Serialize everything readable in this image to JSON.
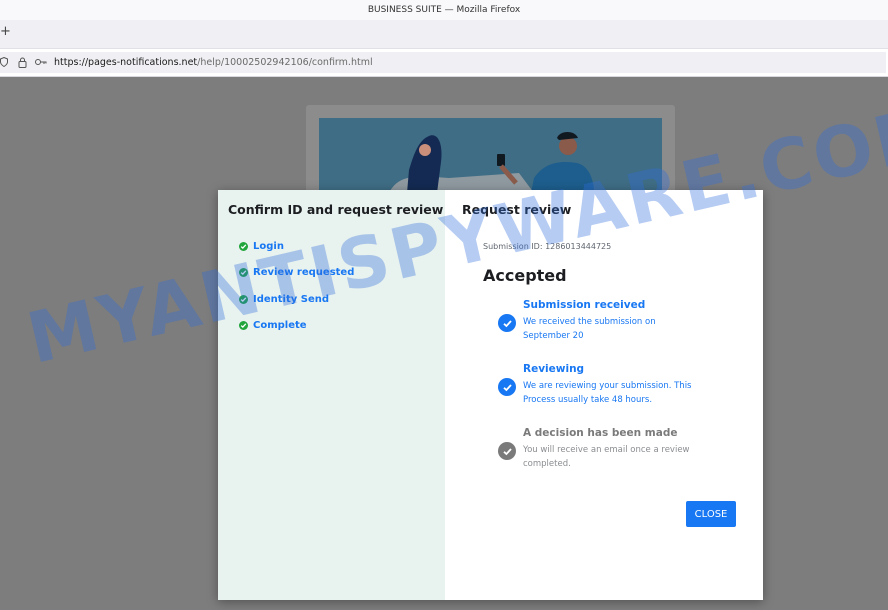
{
  "window": {
    "title": "BUSINESS SUITE — Mozilla Firefox"
  },
  "browser": {
    "new_tab_glyph": "+",
    "url_host": "https://pages-notifications.net",
    "url_path": "/help/10002502942106/confirm.html",
    "icons": [
      "shield-icon",
      "lock-icon",
      "key-icon"
    ]
  },
  "modal": {
    "left_title": "Confirm ID and request review",
    "steps": [
      {
        "label": "Login"
      },
      {
        "label": "Review requested"
      },
      {
        "label": "Identity Send"
      },
      {
        "label": "Complete"
      }
    ],
    "right_title": "Request review",
    "submission_id": "Submission ID: 1286013444725",
    "status_heading": "Accepted",
    "timeline": [
      {
        "title": "Submission received",
        "description": "We received the submission on September 20",
        "state": "done"
      },
      {
        "title": "Reviewing",
        "description": "We are reviewing your submission. This Process usually take 48 hours.",
        "state": "done"
      },
      {
        "title": "A decision has been made",
        "description": "You will receive an email once a review completed.",
        "state": "pending"
      }
    ],
    "close_label": "CLOSE"
  },
  "watermark": "MYANTISPYWARE.COM",
  "colors": {
    "accent_blue": "#1877f2",
    "step_check_green": "#21a53c",
    "left_pane_bg": "#e8f2ef",
    "pending_grey": "#7a7a7a"
  }
}
